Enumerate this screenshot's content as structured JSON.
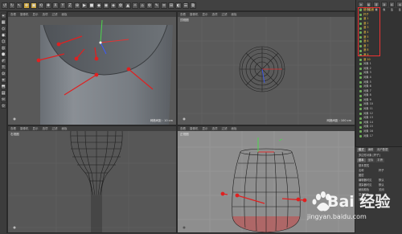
{
  "toolbar": {
    "tools": [
      "↺",
      "↻",
      "↖",
      "✥",
      "▣",
      "⟲",
      "✚",
      "X",
      "Y",
      "Z",
      "⊕",
      "▶",
      "■",
      "◆",
      "◉",
      "◈",
      "✿",
      "▲",
      "☼",
      "⌂",
      "⚙",
      "✎",
      "≡",
      "⊞",
      "◐",
      "☰",
      "⧉"
    ],
    "highlight_indices": [
      3,
      4
    ]
  },
  "sidebar": {
    "tools": [
      "⌖",
      "▦",
      "◇",
      "◆",
      "⬡",
      "◎",
      "⬢",
      "✐",
      "⤧",
      "⊙",
      "⌗",
      "⬒",
      "▤",
      "✂",
      "⟐"
    ]
  },
  "viewports": {
    "menu_items": [
      "查看",
      "摄像机",
      "显示",
      "选项",
      "过滤",
      "面板"
    ],
    "perspective": {
      "label": "",
      "footer": "网格间距 : 10 cm"
    },
    "top": {
      "label": "顶视图",
      "footer": "网格间距 : 100 cm"
    },
    "right": {
      "label": "右视图",
      "footer": "网格间距 : 10 cm"
    },
    "front": {
      "label": "正视图",
      "footer": "网格间距 : 10 cm"
    }
  },
  "object_manager": {
    "tabs": [
      "文件",
      "编辑",
      "查看",
      "对象",
      "标签",
      "书签"
    ],
    "objects": [
      {
        "label": "细分曲面",
        "selected": true
      },
      {
        "label": "杯子",
        "selected": true
      },
      {
        "label": "酒 1",
        "selected": true
      },
      {
        "label": "酒 2",
        "selected": true
      },
      {
        "label": "酒 3",
        "selected": true
      },
      {
        "label": "酒 4",
        "selected": true
      },
      {
        "label": "酒 5",
        "selected": true
      },
      {
        "label": "酒 6",
        "selected": true
      },
      {
        "label": "酒 7",
        "selected": true
      },
      {
        "label": "酒 8",
        "selected": true
      },
      {
        "label": "酒 9",
        "selected": true
      },
      {
        "label": "酒 10",
        "selected": true
      },
      {
        "label": "对象 1",
        "selected": false
      },
      {
        "label": "对象 2",
        "selected": false
      },
      {
        "label": "对象 3",
        "selected": false
      },
      {
        "label": "对象 4",
        "selected": false
      },
      {
        "label": "对象 5",
        "selected": false
      },
      {
        "label": "对象 6",
        "selected": false
      },
      {
        "label": "对象 7",
        "selected": false
      },
      {
        "label": "对象 8",
        "selected": false
      },
      {
        "label": "对象 9",
        "selected": false
      },
      {
        "label": "对象 10",
        "selected": false
      },
      {
        "label": "对象 11",
        "selected": false
      },
      {
        "label": "对象 12",
        "selected": false
      },
      {
        "label": "对象 13",
        "selected": false
      },
      {
        "label": "对象 14",
        "selected": false
      },
      {
        "label": "对象 15",
        "selected": false
      },
      {
        "label": "对象 16",
        "selected": false
      },
      {
        "label": "对象 17",
        "selected": false
      }
    ]
  },
  "attributes": {
    "tabs": [
      "模式",
      "编辑",
      "用户数据"
    ],
    "title": "多边形对象 [杯子]",
    "subtabs": [
      "基本",
      "坐标",
      "平滑"
    ],
    "rows": [
      {
        "label": "基本属性",
        "value": ""
      },
      {
        "label": "名称",
        "value": "杯子"
      },
      {
        "label": "图层",
        "value": ""
      },
      {
        "label": "编辑器可见",
        "value": "默认"
      },
      {
        "label": "渲染器可见",
        "value": "默认"
      },
      {
        "label": "使用颜色",
        "value": "关闭"
      },
      {
        "label": "显示颜色",
        "value": ""
      },
      {
        "label": "透显",
        "value": ""
      }
    ]
  },
  "watermark": {
    "brand": "Bai 经验",
    "url": "jingyan.baidu.com"
  },
  "colors": {
    "accent": "#c8a23a",
    "selection": "#e33333",
    "axis_y": "#4cd84c",
    "axis_z": "#3b5bff"
  }
}
